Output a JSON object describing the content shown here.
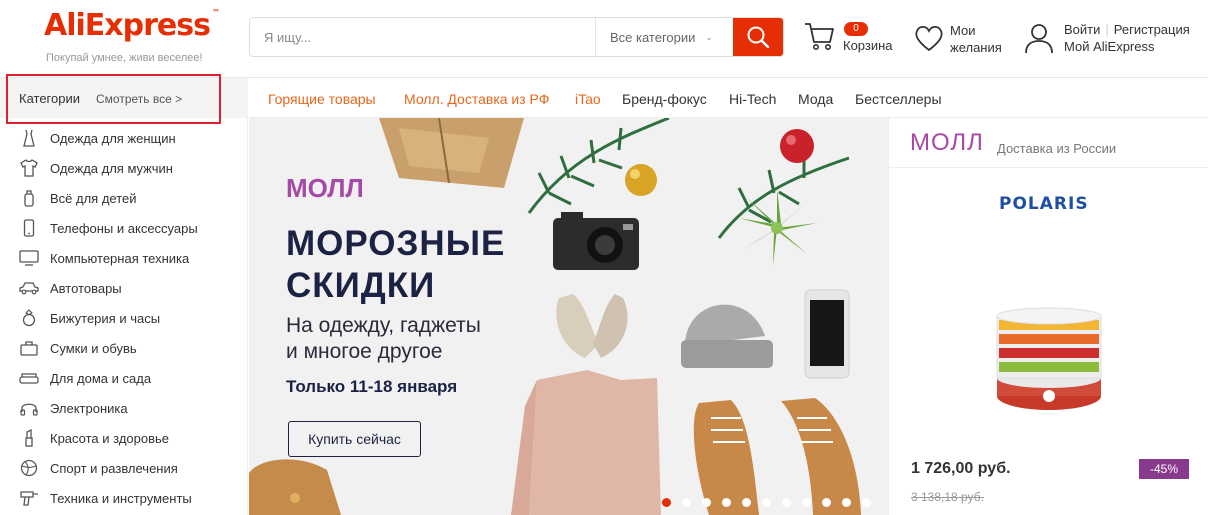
{
  "header": {
    "logo": "AliExpress",
    "logo_tm": "™",
    "slogan": "Покупай умнее, живи веселее!",
    "search": {
      "placeholder": "Я ищу...",
      "category": "Все категории"
    },
    "cart": {
      "count": "0",
      "label": "Корзина"
    },
    "wishlist": {
      "line1": "Мои",
      "line2": "желания"
    },
    "account": {
      "login": "Войти",
      "register": "Регистрация",
      "my": "Мой AliExpress"
    }
  },
  "categories_bar": {
    "title": "Категории",
    "see_all": "Смотреть все >"
  },
  "nav": {
    "items": [
      {
        "label": "Горящие товары",
        "color": "#e8661c"
      },
      {
        "label": "Молл. Доставка из РФ",
        "color": "#e8661c"
      },
      {
        "label": "iTao",
        "color": "#e8661c"
      },
      {
        "label": "Бренд-фокус",
        "color": "#333333"
      },
      {
        "label": "Hi-Tech",
        "color": "#333333"
      },
      {
        "label": "Мода",
        "color": "#333333"
      },
      {
        "label": "Бестселлеры",
        "color": "#333333"
      }
    ]
  },
  "sidebar": {
    "items": [
      {
        "label": "Одежда для женщин",
        "icon": "dress-icon"
      },
      {
        "label": "Одежда для мужчин",
        "icon": "shirt-icon"
      },
      {
        "label": "Всё для детей",
        "icon": "bottle-icon"
      },
      {
        "label": "Телефоны и аксессуары",
        "icon": "phone-icon"
      },
      {
        "label": "Компьютерная техника",
        "icon": "monitor-icon"
      },
      {
        "label": "Автотовары",
        "icon": "car-icon"
      },
      {
        "label": "Бижутерия и часы",
        "icon": "ring-icon"
      },
      {
        "label": "Сумки и обувь",
        "icon": "bag-icon"
      },
      {
        "label": "Для дома и сада",
        "icon": "sofa-icon"
      },
      {
        "label": "Электроника",
        "icon": "headphones-icon"
      },
      {
        "label": "Красота и здоровье",
        "icon": "lipstick-icon"
      },
      {
        "label": "Спорт и развлечения",
        "icon": "ball-icon"
      },
      {
        "label": "Техника и инструменты",
        "icon": "drill-icon"
      }
    ]
  },
  "banner": {
    "mall": "МОЛЛ",
    "title_line1": "МОРОЗНЫЕ",
    "title_line2": "СКИДКИ",
    "subtitle_line1": "На одежду, гаджеты",
    "subtitle_line2": "и многое другое",
    "dates": "Только 11-18 января",
    "button": "Купить сейчас",
    "active_slide": 1,
    "slide_count": 11
  },
  "mall_panel": {
    "title": "МОЛЛ",
    "subtitle": "Доставка из России",
    "brand": "POLARIS",
    "price": "1 726,00 руб.",
    "old_price": "3 138,18 руб.",
    "discount": "-45%"
  },
  "colors": {
    "accent": "#e62e04",
    "mall_purple": "#a64aa8",
    "nav_orange": "#e8661c"
  }
}
